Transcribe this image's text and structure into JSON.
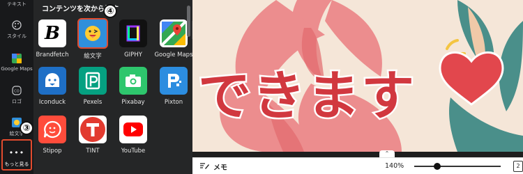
{
  "rail": {
    "top_label": "テキスト",
    "items": [
      {
        "label": "スタイル",
        "icon": "palette-icon"
      },
      {
        "label": "Google Maps",
        "icon": "google-maps-icon"
      },
      {
        "label": "ロゴ",
        "icon": "logo-icon"
      },
      {
        "label": "絵文字",
        "icon": "emoji-icon"
      }
    ],
    "more": {
      "dots": "•••",
      "label": "もっと見る"
    }
  },
  "markers": {
    "three": "③",
    "four": "④"
  },
  "panel": {
    "title": "コンテンツを次から探す",
    "apps": [
      {
        "name": "Brandfetch",
        "glyph": "B",
        "bg": "#ffffff"
      },
      {
        "name": "絵文字",
        "glyph": "😜",
        "bg": "#2f8fdb"
      },
      {
        "name": "GIPHY",
        "glyph": "",
        "bg": "#111111"
      },
      {
        "name": "Google Maps",
        "glyph": "",
        "bg": "#ffffff"
      },
      {
        "name": "Iconduck",
        "glyph": "",
        "bg": "#1e6fc6"
      },
      {
        "name": "Pexels",
        "glyph": "P",
        "bg": "#05a081"
      },
      {
        "name": "Pixabay",
        "glyph": "",
        "bg": "#2ec66d"
      },
      {
        "name": "Pixton",
        "glyph": "P",
        "bg": "#2c8de0"
      },
      {
        "name": "Stipop",
        "glyph": "☺",
        "bg": "#ff4c3b"
      },
      {
        "name": "TINT",
        "glyph": "T",
        "bg": "#e23a2f"
      },
      {
        "name": "YouTube",
        "glyph": "▶",
        "bg": "#ffffff"
      }
    ]
  },
  "canvas": {
    "text": "できます",
    "text_color": "#d1383f"
  },
  "bottom": {
    "memo_label": "メモ",
    "zoom_label": "140%",
    "zoom_fraction": 0.27,
    "page_number": "2"
  }
}
